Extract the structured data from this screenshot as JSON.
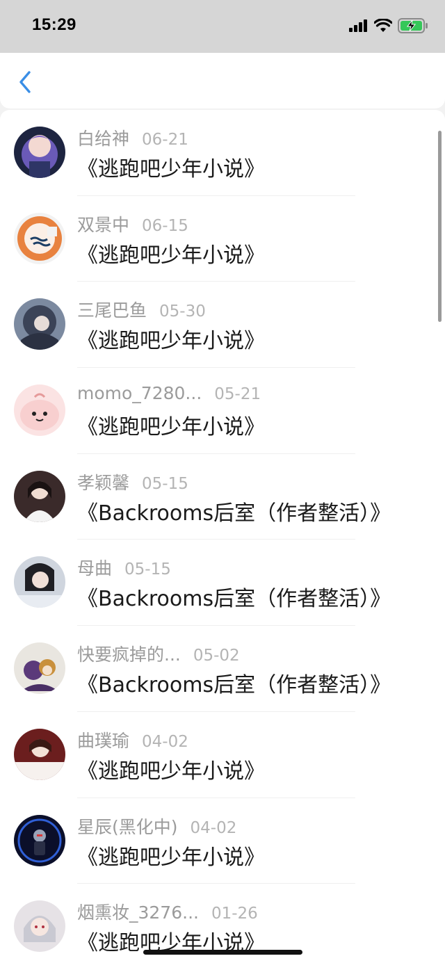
{
  "status_bar": {
    "time": "15:29",
    "icons": [
      "signal-icon",
      "wifi-icon",
      "battery-charging-icon"
    ]
  },
  "nav": {
    "back_icon": "chevron-left-icon",
    "accent_color": "#3a8ee6"
  },
  "items": [
    {
      "user": "白给神",
      "date": "06-21",
      "title": "《逃跑吧少年小说》",
      "avatar": "avatar-anime-girl-purple"
    },
    {
      "user": "双景中",
      "date": "06-15",
      "title": "《逃跑吧少年小说》",
      "avatar": "avatar-orange-logo"
    },
    {
      "user": "三尾巴鱼",
      "date": "05-30",
      "title": "《逃跑吧少年小说》",
      "avatar": "avatar-anime-dark-hair"
    },
    {
      "user": "momo_7280...",
      "date": "05-21",
      "title": "《逃跑吧少年小说》",
      "avatar": "avatar-pink-cartoon"
    },
    {
      "user": "孝颖馨",
      "date": "05-15",
      "title": "《Backrooms后室（作者整活）》",
      "avatar": "avatar-photo-girl"
    },
    {
      "user": "母曲",
      "date": "05-15",
      "title": "《Backrooms后室（作者整活）》",
      "avatar": "avatar-photo-girl-2"
    },
    {
      "user": "快要疯掉的...",
      "date": "05-02",
      "title": "《Backrooms后室（作者整活）》",
      "avatar": "avatar-anime-duo"
    },
    {
      "user": "曲璞瑜",
      "date": "04-02",
      "title": "《逃跑吧少年小说》",
      "avatar": "avatar-photo-text"
    },
    {
      "user": "星辰(黑化中)",
      "date": "04-02",
      "title": "《逃跑吧少年小说》",
      "avatar": "avatar-dark-figure"
    },
    {
      "user": "烟熏妆_3276...",
      "date": "01-26",
      "title": "《逃跑吧少年小说》",
      "avatar": "avatar-anime-white-hair"
    }
  ]
}
